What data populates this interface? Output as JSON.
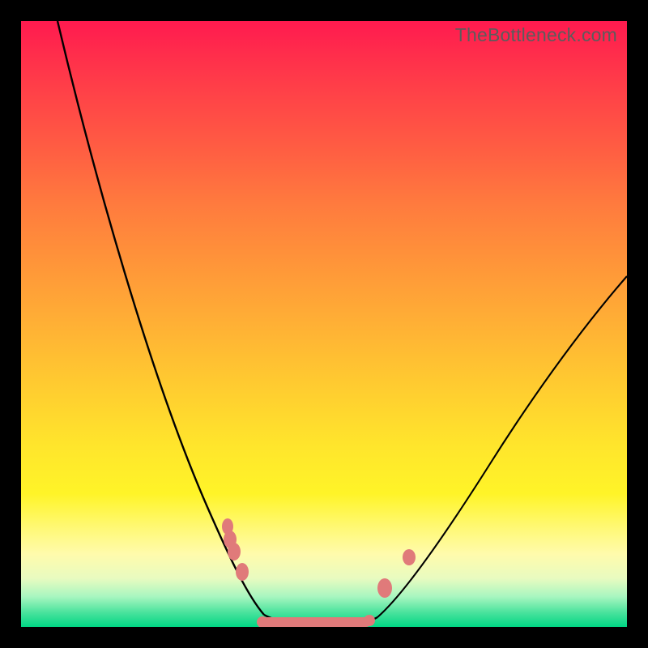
{
  "watermark": "TheBottleneck.com",
  "chart_data": {
    "type": "line",
    "title": "",
    "xlabel": "",
    "ylabel": "",
    "x_range": [
      0,
      1
    ],
    "y_range": [
      0,
      1
    ],
    "curve": {
      "description": "V-shaped bottleneck curve (higher = worse mismatch)",
      "left_branch": {
        "x": [
          0.06,
          0.4
        ],
        "y": [
          1.0,
          0.02
        ]
      },
      "right_branch": {
        "x": [
          0.58,
          1.0
        ],
        "y": [
          0.02,
          0.58
        ]
      },
      "trough": {
        "x": [
          0.4,
          0.58
        ],
        "y": 0.007
      }
    },
    "markers": [
      {
        "x": 0.345,
        "y": 0.145
      },
      {
        "x": 0.352,
        "y": 0.125
      },
      {
        "x": 0.342,
        "y": 0.165
      },
      {
        "x": 0.365,
        "y": 0.09
      },
      {
        "x": 0.6,
        "y": 0.065
      },
      {
        "x": 0.64,
        "y": 0.115
      }
    ],
    "trough_band": {
      "x_start": 0.395,
      "x_end": 0.575,
      "y": 0.007,
      "height": 0.018
    },
    "background_gradient": {
      "top": "#ff1a4f",
      "upper_mid": "#ff9539",
      "mid": "#ffe52c",
      "lower_mid": "#fffbac",
      "bottom": "#00d684"
    }
  }
}
